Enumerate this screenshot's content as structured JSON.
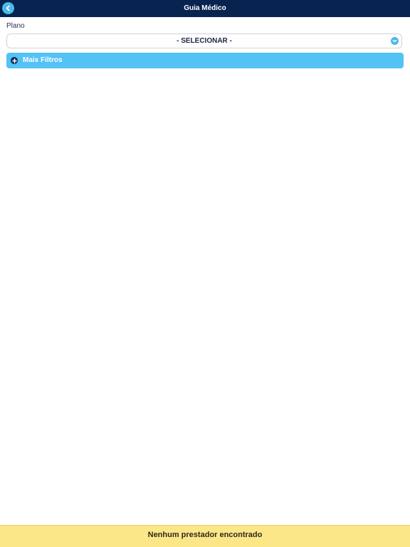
{
  "header": {
    "title": "Guia Médico",
    "back_icon": "chevron-left-icon"
  },
  "form": {
    "plano_label": "Plano",
    "plano_selected": "- SELECIONAR -",
    "chevron_icon": "chevron-down-icon"
  },
  "filters": {
    "label": "Mais Filtros",
    "icon": "plus-circle-icon"
  },
  "status": {
    "message": "Nenhum prestador encontrado"
  },
  "colors": {
    "header_bg": "#072350",
    "accent": "#4db8ea",
    "filters_bg": "#53c2f4",
    "status_bg": "#fbe787"
  }
}
